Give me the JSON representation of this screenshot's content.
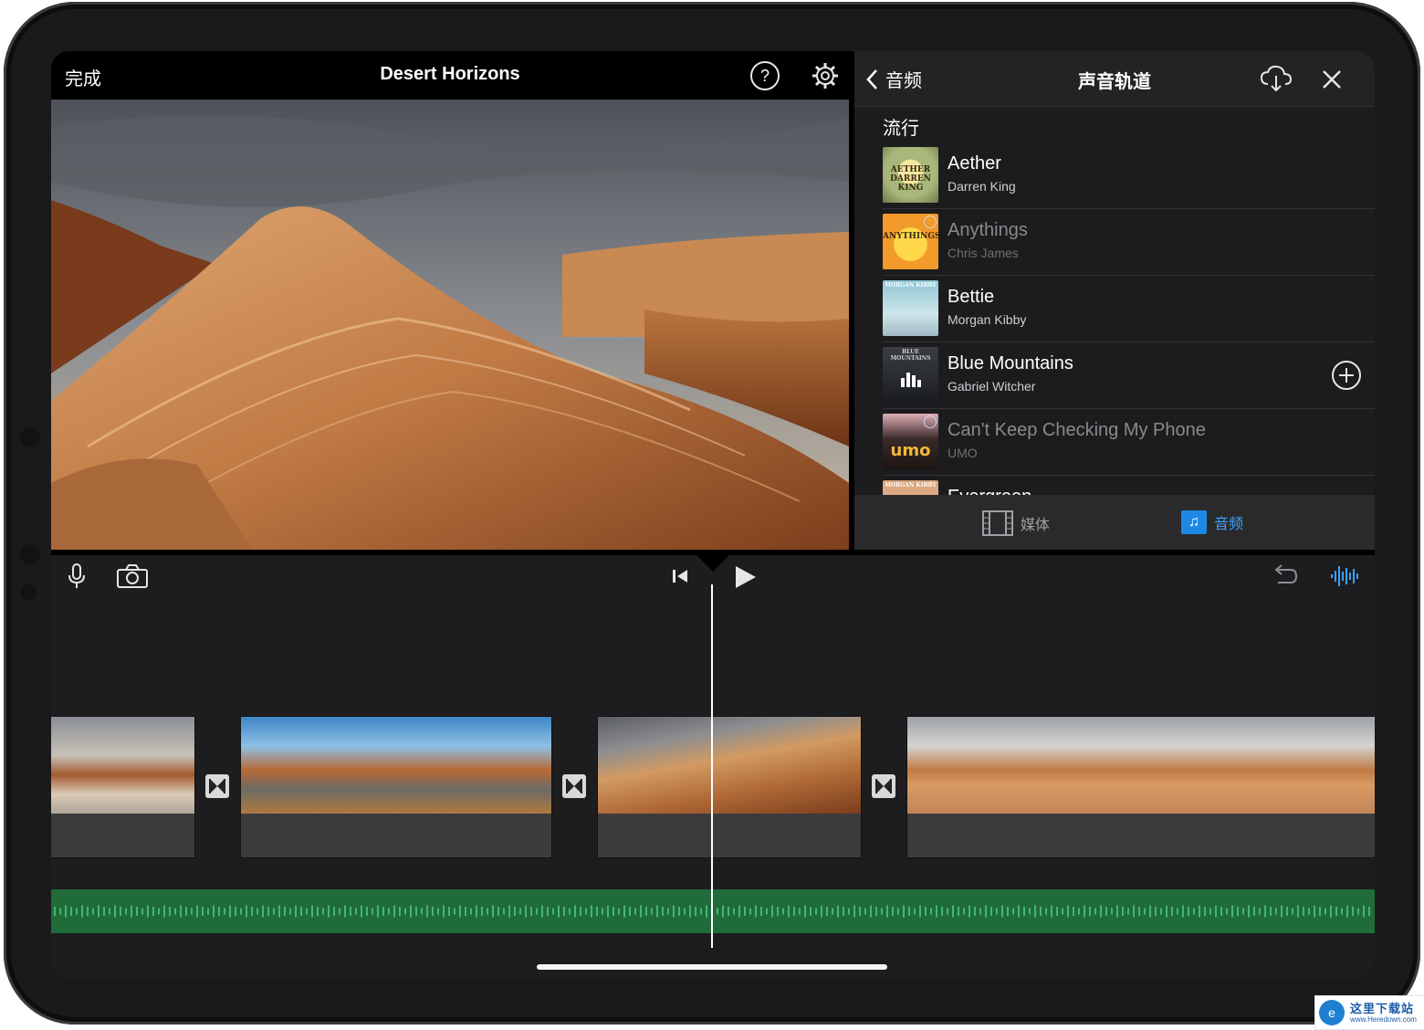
{
  "viewer": {
    "done_label": "完成",
    "project_title": "Desert Horizons"
  },
  "audio_panel": {
    "back_label": "音频",
    "title": "声音轨道",
    "section": "流行",
    "songs": [
      {
        "title": "Aether",
        "artist": "Darren King",
        "art_text": "AETHER DARREN KING"
      },
      {
        "title": "Anythings",
        "artist": "Chris James",
        "art_text": "ANYTHINGS"
      },
      {
        "title": "Bettie",
        "artist": "Morgan Kibby",
        "art_text": "MORGAN KIBBY"
      },
      {
        "title": "Blue Mountains",
        "artist": "Gabriel Witcher",
        "art_text": "BLUE MOUNTAINS"
      },
      {
        "title": "Can't Keep Checking My Phone",
        "artist": "UMO",
        "art_text": "umo"
      },
      {
        "title": "Evergreen",
        "artist": "",
        "art_text": "MORGAN KIBBY"
      }
    ],
    "tabs": {
      "media": "媒体",
      "audio": "音频"
    },
    "icons": [
      "chevron-left-icon",
      "cloud-download-icon",
      "close-icon",
      "plus-circle-icon",
      "film-icon",
      "music-note-icon"
    ]
  },
  "timeline": {
    "icons": [
      "microphone-icon",
      "camera-icon",
      "skip-back-icon",
      "play-icon",
      "undo-icon",
      "waveform-icon"
    ]
  },
  "watermark": {
    "line1": "这里下载站",
    "line2": "www.Heredown.com"
  },
  "colors": {
    "accent_blue": "#3ea1ff",
    "audio_track_green": "#1f6b3a",
    "waveform_green": "#4fd384"
  }
}
